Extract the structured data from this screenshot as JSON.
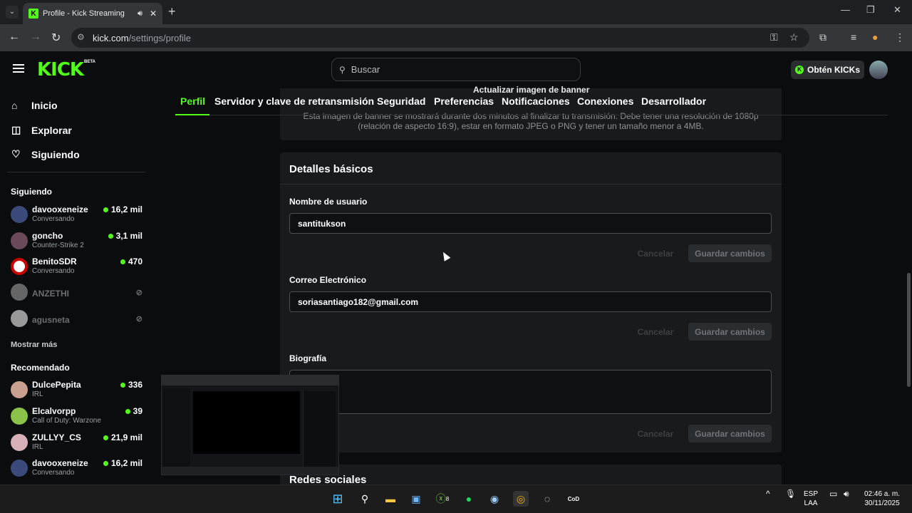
{
  "browser": {
    "tab_title": "Profile - Kick Streaming",
    "url_host": "kick.com",
    "url_path": "/settings/profile"
  },
  "site": {
    "logo": "KICK",
    "beta": "BETA",
    "search_placeholder": "Buscar",
    "get_kicks": "Obtén KICKs"
  },
  "sidebar": {
    "nav": [
      {
        "label": "Inicio",
        "icon": "home-icon"
      },
      {
        "label": "Explorar",
        "icon": "compass-icon"
      },
      {
        "label": "Siguiendo",
        "icon": "heart-icon"
      }
    ],
    "following_title": "Siguiendo",
    "following": [
      {
        "name": "davooxeneize",
        "category": "Conversando",
        "viewers": "16,2 mil",
        "live": true
      },
      {
        "name": "goncho",
        "category": "Counter-Strike 2",
        "viewers": "3,1 mil",
        "live": true
      },
      {
        "name": "BenitoSDR",
        "category": "Conversando",
        "viewers": "470",
        "live": true
      },
      {
        "name": "ANZETHI",
        "category": "",
        "viewers": "",
        "live": false
      },
      {
        "name": "agusneta",
        "category": "",
        "viewers": "",
        "live": false
      }
    ],
    "show_more": "Mostrar más",
    "recommended_title": "Recomendado",
    "recommended": [
      {
        "name": "DulcePepita",
        "category": "IRL",
        "viewers": "336"
      },
      {
        "name": "Elcalvorpp",
        "category": "Call of Duty: Warzone",
        "viewers": "39"
      },
      {
        "name": "ZULLYY_CS",
        "category": "IRL",
        "viewers": "21,9 mil"
      },
      {
        "name": "davooxeneize",
        "category": "Conversando",
        "viewers": "16,2 mil"
      }
    ]
  },
  "settings_tabs": [
    "Perfil",
    "Servidor y clave de retransmisión",
    "Seguridad",
    "Preferencias",
    "Notificaciones",
    "Conexiones",
    "Desarrollador"
  ],
  "banner": {
    "title": "Actualizar imagen de banner",
    "description": "Esta imagen de banner se mostrará durante dos minutos al finalizar tu transmisión. Debe tener una resolución de 1080p (relación de aspecto 16:9), estar en formato JPEG o PNG y tener un tamaño menor a 4MB."
  },
  "basic": {
    "title": "Detalles básicos",
    "username_label": "Nombre de usuario",
    "username_value": "santitukson",
    "email_label": "Correo Electrónico",
    "email_value": "soriasantiago182@gmail.com",
    "bio_label": "Biografía",
    "bio_value": "",
    "cancel": "Cancelar",
    "save": "Guardar cambios"
  },
  "social": {
    "title": "Redes sociales"
  },
  "taskbar": {
    "lang1": "ESP",
    "lang2": "LAA",
    "time": "02:46 a. m.",
    "date": "30/11/2025",
    "xbox_badge": "8"
  },
  "colors": {
    "accent": "#53fc18",
    "bg": "#0b0c0d",
    "card": "#181a1b"
  }
}
